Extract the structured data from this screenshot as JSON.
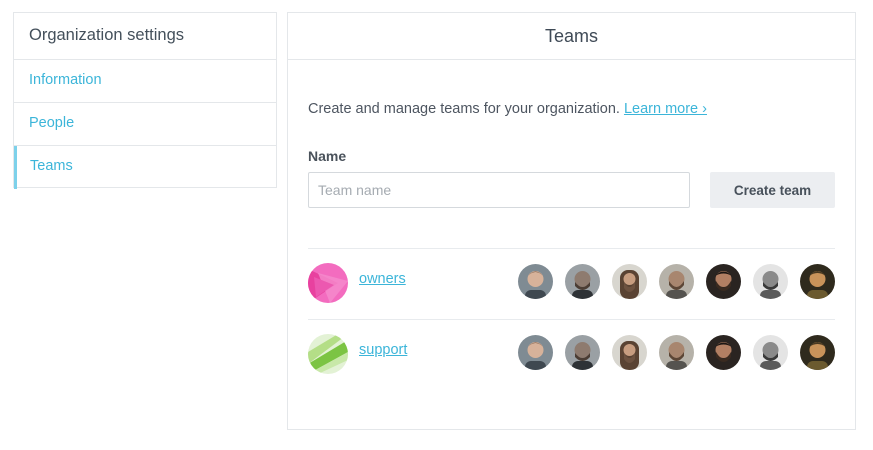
{
  "sidebar": {
    "title": "Organization settings",
    "items": [
      {
        "label": "Information",
        "active": false
      },
      {
        "label": "People",
        "active": false
      },
      {
        "label": "Teams",
        "active": true
      }
    ]
  },
  "main": {
    "title": "Teams",
    "intro_text": "Create and manage teams for your organization.",
    "learn_more": "Learn more ›",
    "name_label": "Name",
    "name_placeholder": "Team name",
    "name_value": "",
    "create_button": "Create team"
  },
  "teams": [
    {
      "name": "owners",
      "avatar_colors": [
        "#f15fb8",
        "#e63ea0"
      ],
      "member_count": 7
    },
    {
      "name": "support",
      "avatar_colors": [
        "#a8d872",
        "#6fc142"
      ],
      "member_count": 7
    }
  ],
  "colors": {
    "accent": "#3cb5d9",
    "active_border": "#7dd1ea",
    "border": "#e4e7ea",
    "button_bg": "#eceef1"
  }
}
